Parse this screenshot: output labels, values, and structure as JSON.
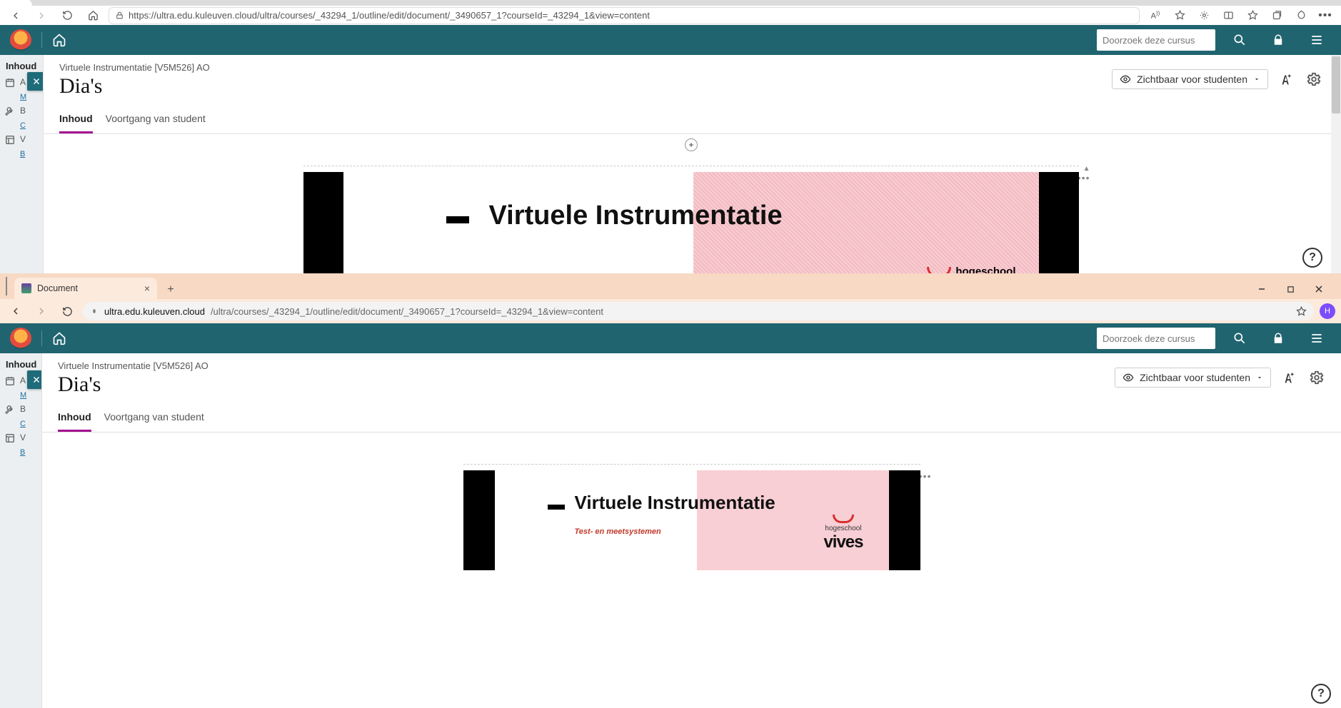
{
  "url": "https://ultra.edu.kuleuven.cloud/ultra/courses/_43294_1/outline/edit/document/_3490657_1?courseId=_43294_1&view=content",
  "url_display_prefix": "ultra.edu.kuleuven.cloud",
  "url_display_path": "/ultra/courses/_43294_1/outline/edit/document/_3490657_1?courseId=_43294_1&view=content",
  "search_placeholder": "Doorzoek deze cursus",
  "sidebar": {
    "title": "Inhoud",
    "items": [
      {
        "letter": "A",
        "sub": "M"
      },
      {
        "letter": "B",
        "sub": "C"
      },
      {
        "letter": "V",
        "sub": "B"
      }
    ]
  },
  "doc": {
    "breadcrumb": "Virtuele Instrumentatie [V5M526] AO",
    "title": "Dia's",
    "visibility": "Zichtbaar voor studenten",
    "tabs": {
      "content": "Inhoud",
      "progress": "Voortgang van student"
    }
  },
  "slide": {
    "title": "Virtuele Instrumentatie",
    "subtitle": "Test- en meetsystemen",
    "school_prefix": "hogeschool",
    "school": "vives"
  },
  "chrome": {
    "tab_label": "Document",
    "avatar_letter": "H"
  }
}
